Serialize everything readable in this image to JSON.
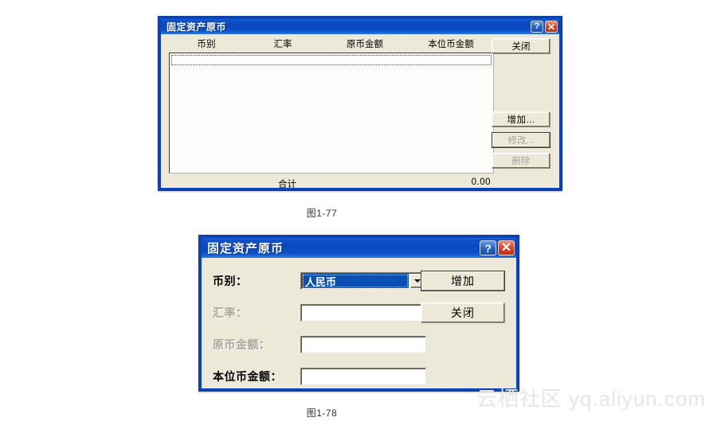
{
  "page": {
    "watermark": "云栖社区 yq.aliyun.com"
  },
  "dialog1": {
    "title": "固定资产原币",
    "titlebar_buttons": {
      "help": "?",
      "close": "✕"
    },
    "columns": [
      "币别",
      "汇率",
      "原币金额",
      "本位币金额"
    ],
    "rows": [],
    "total": {
      "label": "合计",
      "value": "0.00"
    },
    "buttons": {
      "close": "关闭",
      "add": "增加...",
      "edit": "修改...",
      "delete": "删除"
    }
  },
  "dialog2": {
    "title": "固定资产原币",
    "titlebar_buttons": {
      "help": "?",
      "close": "✕"
    },
    "fields": [
      {
        "label": "币别：",
        "type": "combo",
        "value": "人民币",
        "enabled": true
      },
      {
        "label": "汇率：",
        "type": "text",
        "value": "",
        "enabled": false
      },
      {
        "label": "原币金额：",
        "type": "text",
        "value": "",
        "enabled": false
      },
      {
        "label": "本位币金额：",
        "type": "text",
        "value": "",
        "enabled": true
      }
    ],
    "buttons": {
      "add": "增加",
      "close": "关闭"
    }
  },
  "captions": {
    "figure1": "图1-77",
    "figure2": "图1-78"
  }
}
